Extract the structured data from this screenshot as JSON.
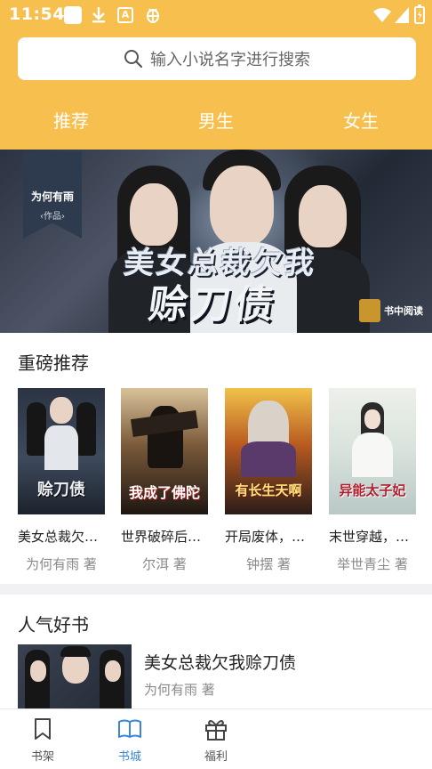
{
  "status_bar": {
    "time": "11:54",
    "icons": [
      "notification-square-icon",
      "download-icon",
      "a-badge-icon",
      "bug-icon",
      "wifi-icon",
      "signal-icon",
      "battery-icon"
    ],
    "a_badge": "A"
  },
  "search": {
    "placeholder": "输入小说名字进行搜索",
    "icon": "search-icon"
  },
  "tabs": [
    {
      "label": "推荐",
      "active": true
    },
    {
      "label": "男生",
      "active": false
    },
    {
      "label": "女生",
      "active": false
    }
  ],
  "banner": {
    "author": "为何有雨",
    "works_label": "‹作品›",
    "title_line1": "美女总裁欠我",
    "title_line2": "赊刀债",
    "logo_text": "书中阅读"
  },
  "recommend": {
    "title": "重磅推荐",
    "books": [
      {
        "name": "美女总裁欠…",
        "author": "为何有雨 著",
        "cover_text": "赊刀债"
      },
      {
        "name": "世界破碎后…",
        "author": "尔洱 著",
        "cover_text": "我成了佛陀"
      },
      {
        "name": "开局废体，…",
        "author": "钟摆 著",
        "cover_text": "有长生天啊"
      },
      {
        "name": "末世穿越，…",
        "author": "举世青尘 著",
        "cover_text": "异能太子妃"
      }
    ]
  },
  "popular": {
    "title": "人气好书",
    "book": {
      "name": "美女总裁欠我赊刀债",
      "author": "为何有雨 著"
    }
  },
  "bottom_nav": [
    {
      "label": "书架",
      "icon": "bookmark-icon",
      "active": false
    },
    {
      "label": "书城",
      "icon": "open-book-icon",
      "active": true
    },
    {
      "label": "福利",
      "icon": "gift-icon",
      "active": false
    }
  ],
  "colors": {
    "header_bg": "#F7C04E",
    "accent_blue": "#3a86d8",
    "text_primary": "#222222",
    "text_secondary": "#8a8a8a"
  }
}
